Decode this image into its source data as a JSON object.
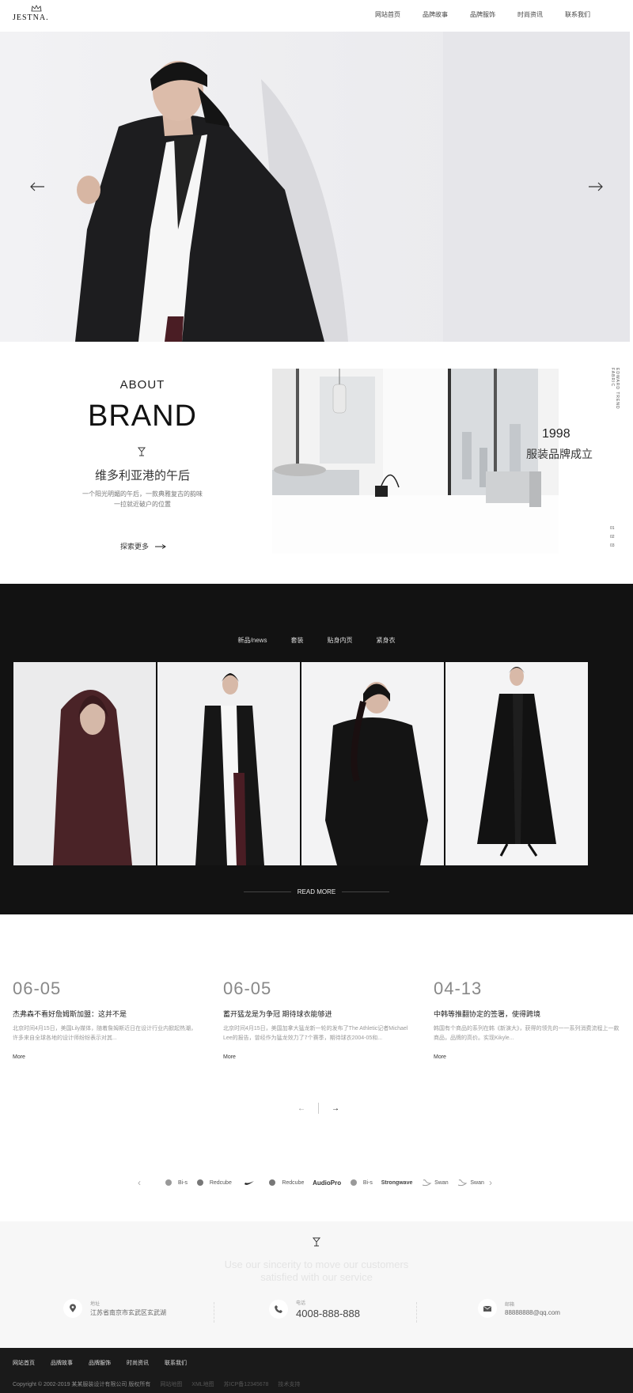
{
  "nav": {
    "logo": "JESTNA.",
    "items": [
      "网站首页",
      "品牌故事",
      "品牌服饰",
      "时尚资讯",
      "联系我们"
    ]
  },
  "about": {
    "heading": "ABOUT",
    "brand": "BRAND",
    "subtitle": "维多利亚港的午后",
    "desc_line1": "一个阳光明媚的午后，一款典雅复古的韵味",
    "desc_line2": "一拉就近破户的位置",
    "explore": "探索更多",
    "year": "1998",
    "year_caption": "服装品牌成立",
    "vertical": "EDWARD TREND FABRIC",
    "dots": [
      "01",
      "02",
      "03"
    ]
  },
  "products": {
    "tabs": [
      "新品/news",
      "套装",
      "贴身内页",
      "紧身衣"
    ],
    "read_more": "READ MORE"
  },
  "news": {
    "items": [
      {
        "date": "06-05",
        "title": "杰弗森不看好詹姆斯加盟：这并不是",
        "desc": "北京时间4月15日，美国Lily媒体，随着詹姆斯近日在设计行业内掀起热潮，许多来自全球各地的设计师纷纷表示对其...",
        "more": "More"
      },
      {
        "date": "06-05",
        "title": "蓄开猛龙是为争冠 期待球衣能够进",
        "desc": "北京时间4月15日，美国加拿大猛龙新一轮的发布了The Athletic记者Michael Lee的报告，曾经作为猛龙效力了7个赛季，期待球衣2004-05和...",
        "more": "More"
      },
      {
        "date": "04-13",
        "title": "中韩等推翻协定的签署，使得跨境",
        "desc": "韩国有个商品的系列在韩《新演大》，获得的领先的一一系列消费流程上一款商品，品牌的高价。实现Kikyle...",
        "more": "More"
      }
    ],
    "pager_prev": "←",
    "pager_next": "→"
  },
  "partners": {
    "logos": [
      "Bi-s",
      "Redcube",
      "NIKE",
      "Redcube",
      "AudioPro",
      "Bi-s",
      "Strongwave",
      "Swan",
      "Swan"
    ]
  },
  "contact": {
    "slogan_line1": "Use our sincerity to move our customers",
    "slogan_line2": "satisfied with our service",
    "address_label": "地址",
    "address": "江苏省南京市玄武区玄武湖",
    "phone_label": "电话",
    "phone": "4008-888-888",
    "email_label": "邮箱",
    "email": "88888888@qq.com"
  },
  "footer": {
    "menu": [
      "网站首页",
      "品牌故事",
      "品牌服饰",
      "时尚资讯",
      "联系我们"
    ],
    "copyright": "Copyright © 2002-2019 某某服装设计有限公司 版权所有",
    "links": [
      "网站地图",
      "XML地图",
      "苏ICP备12345678",
      "技术支持"
    ]
  },
  "colors": {
    "dark_section": "#121212",
    "footer_bg": "#1a1a1a",
    "contact_bg": "#f7f7f7"
  }
}
